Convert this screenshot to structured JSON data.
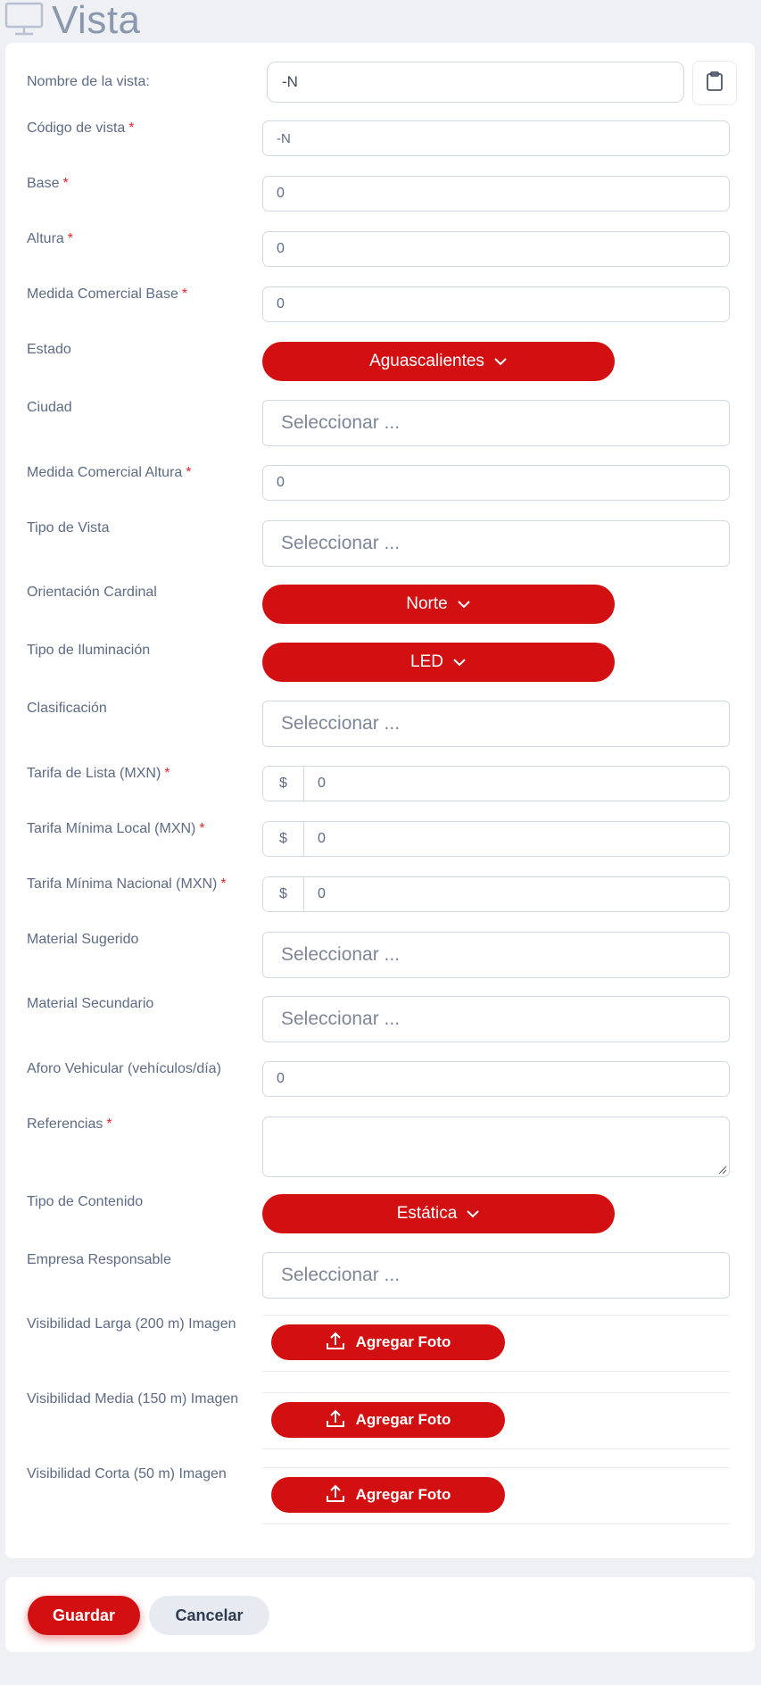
{
  "page": {
    "title": "Vista",
    "icon": "monitor-icon"
  },
  "form": {
    "nombre": {
      "label": "Nombre de la vista:",
      "value": "-N"
    },
    "codigo": {
      "label": "Código de vista",
      "value": "-N"
    },
    "base": {
      "label": "Base",
      "value": "0"
    },
    "altura": {
      "label": "Altura",
      "value": "0"
    },
    "medida_base": {
      "label": "Medida Comercial Base",
      "value": "0"
    },
    "estado": {
      "label": "Estado",
      "value": "Aguascalientes"
    },
    "ciudad": {
      "label": "Ciudad",
      "placeholder": "Seleccionar ..."
    },
    "medida_altura": {
      "label": "Medida Comercial Altura",
      "value": "0"
    },
    "tipo_vista": {
      "label": "Tipo de Vista",
      "placeholder": "Seleccionar ..."
    },
    "orientacion": {
      "label": "Orientación Cardinal",
      "value": "Norte"
    },
    "iluminacion": {
      "label": "Tipo de Iluminación",
      "value": "LED"
    },
    "clasificacion": {
      "label": "Clasificación",
      "placeholder": "Seleccionar ..."
    },
    "tarifa_lista": {
      "label": "Tarifa de Lista (MXN)",
      "prefix": "$",
      "value": "0"
    },
    "tarifa_local": {
      "label": "Tarifa Mínima Local (MXN)",
      "prefix": "$",
      "value": "0"
    },
    "tarifa_nacional": {
      "label": "Tarifa Mínima Nacional (MXN)",
      "prefix": "$",
      "value": "0"
    },
    "material_sugerido": {
      "label": "Material Sugerido",
      "placeholder": "Seleccionar ..."
    },
    "material_secundario": {
      "label": "Material Secundario",
      "placeholder": "Seleccionar ..."
    },
    "aforo": {
      "label": "Aforo Vehicular (vehículos/día)",
      "value": "0"
    },
    "referencias": {
      "label": "Referencias",
      "value": ""
    },
    "tipo_contenido": {
      "label": "Tipo de Contenido",
      "value": "Estática"
    },
    "empresa": {
      "label": "Empresa Responsable",
      "placeholder": "Seleccionar ..."
    },
    "vis_larga": {
      "label": "Visibilidad Larga (200 m) Imagen",
      "button": "Agregar Foto"
    },
    "vis_media": {
      "label": "Visibilidad Media (150 m) Imagen",
      "button": "Agregar Foto"
    },
    "vis_corta": {
      "label": "Visibilidad Corta (50 m) Imagen",
      "button": "Agregar Foto"
    },
    "required_mark": "*"
  },
  "footer": {
    "save_label": "Guardar",
    "cancel_label": "Cancelar"
  },
  "colors": {
    "accent": "#d21011",
    "label": "#5d6b85",
    "required": "#e3262c"
  }
}
